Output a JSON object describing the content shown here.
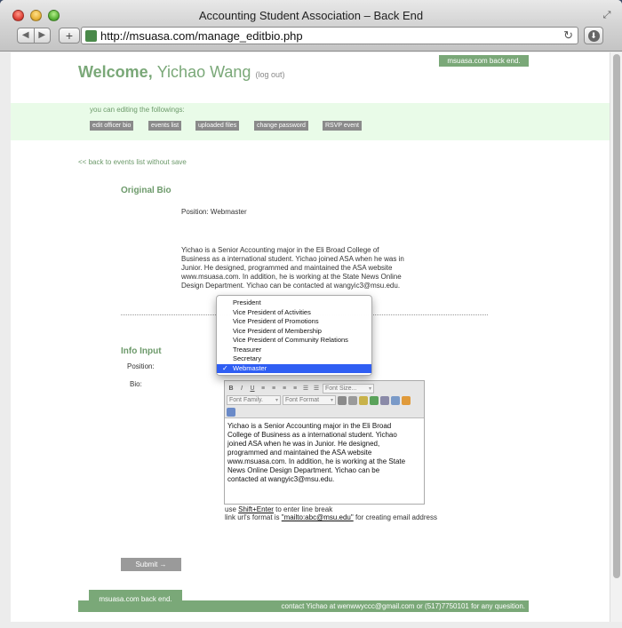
{
  "window": {
    "title": "Accounting Student Association – Back End",
    "url": "http://msuasa.com/manage_editbio.php"
  },
  "header": {
    "welcome": "Welcome,",
    "user_name": "Yichao Wang",
    "logout": "(log out)",
    "backend_tab": "msuasa.com back end."
  },
  "menu": {
    "caption": "you can editing the followings:",
    "items": [
      {
        "label": "edit officer bio"
      },
      {
        "label": "events list"
      },
      {
        "label": "uploaded files"
      },
      {
        "label": "change password"
      },
      {
        "label": "RSVP event"
      }
    ]
  },
  "back_link": "<< back to events list without save",
  "original_bio": {
    "title": "Original Bio",
    "position_line": "Position: Webmaster",
    "text_lines": [
      "Yichao is a Senior Accounting major in the Eli Broad College of",
      "Business as a international student. Yichao joined ASA when he was in",
      "Junior. He designed, programmed and maintained the ASA website",
      "www.msuasa.com. In addition, he is working at the State News Online",
      "Design Department. Yichao can be contacted at wangyic3@msu.edu."
    ]
  },
  "info_input": {
    "title": "Info Input",
    "position_label": "Position:",
    "bio_label": "Bio:",
    "position_options": [
      "President",
      "Vice President of Activities",
      "Vice President of Promotions",
      "Vice President of Membership",
      "Vice President of Community Relations",
      "Treasurer",
      "Secretary",
      "Webmaster"
    ],
    "selected_position": "Webmaster",
    "toolbar": {
      "font_size": "Font Size...",
      "font_family": "Font Family.",
      "font_format": "Font Format"
    },
    "bio_lines": [
      "Yichao is a Senior Accounting major in the Eli Broad",
      "College of Business as a international student. Yichao",
      "joined ASA when he was in Junior. He designed,",
      "programmed and maintained the ASA website",
      "www.msuasa.com. In addition, he is working at the State",
      "News Online Design Department. Yichao can be",
      "contacted at wangyic3@msu.edu."
    ],
    "hint1_prefix": "use ",
    "hint1_key": "Shift+Enter",
    "hint1_suffix": " to enter line break",
    "hint2_prefix": "link url's format is ",
    "hint2_code": "\"mailto:abc@msu.edu\"",
    "hint2_suffix": " for creating email address",
    "submit": "Submit →"
  },
  "footer": {
    "tab": "msuasa.com back end.",
    "contact": "contact Yichao at wenwwyccc@gmail.com or (517)7750101 for any quesition."
  }
}
